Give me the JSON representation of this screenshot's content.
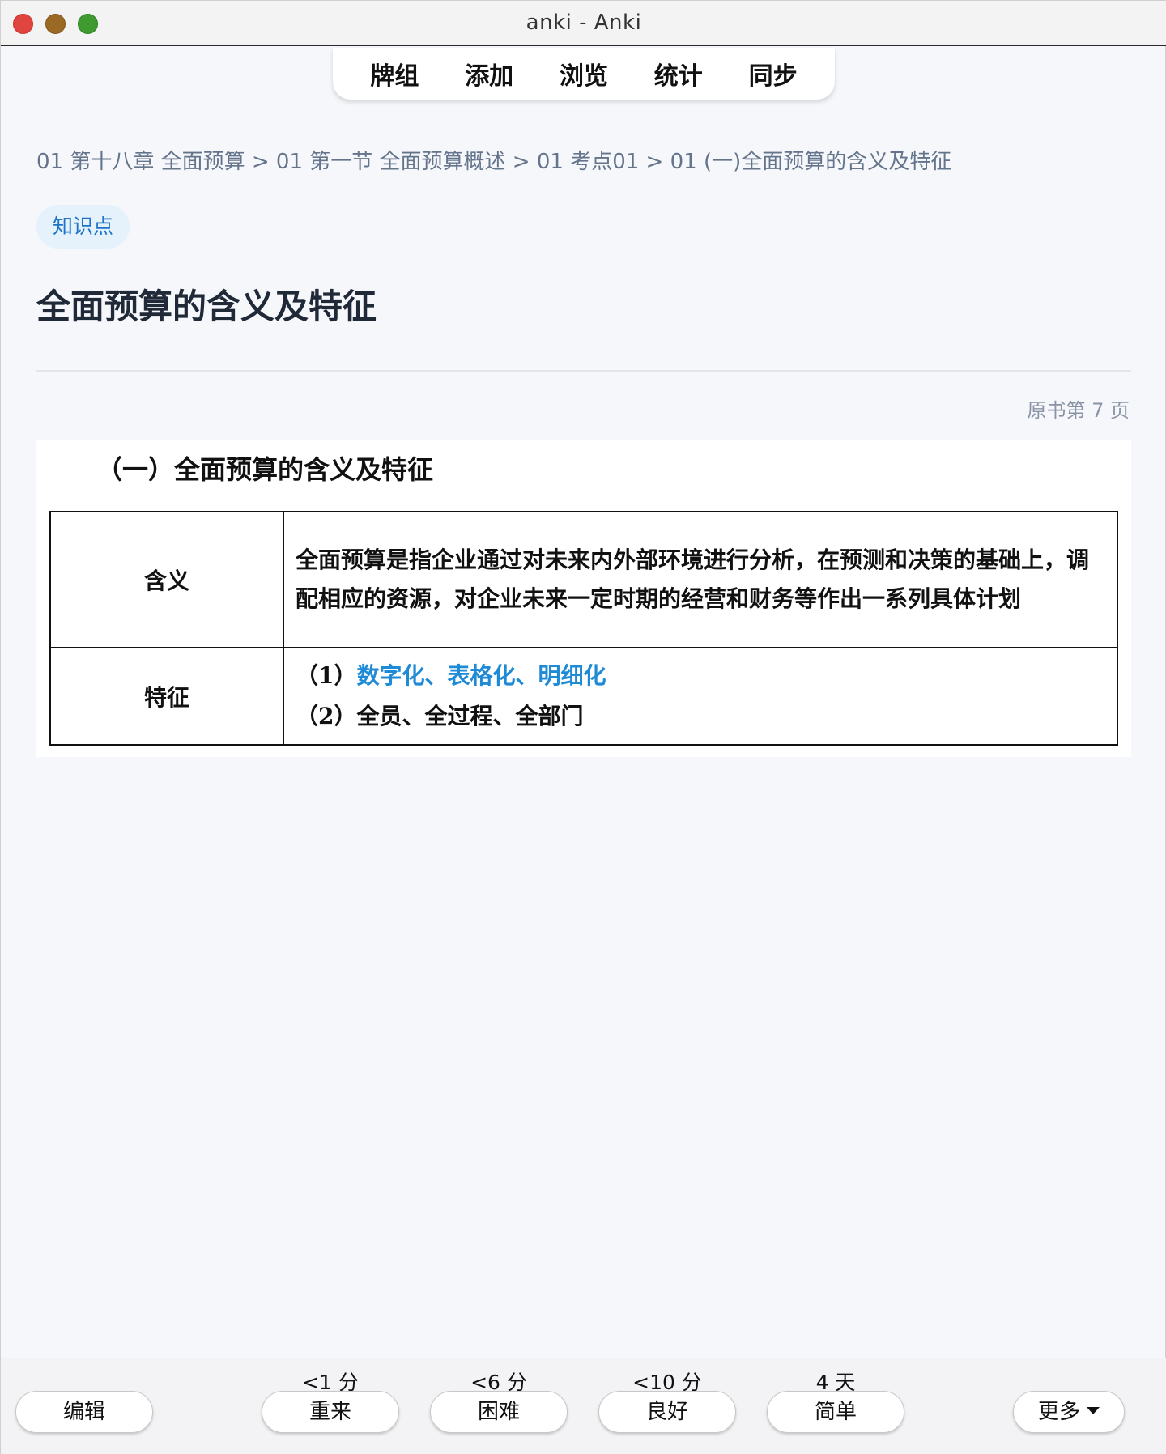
{
  "window": {
    "title": "anki - Anki"
  },
  "toolbar": {
    "items": [
      "牌组",
      "添加",
      "浏览",
      "统计",
      "同步"
    ]
  },
  "card": {
    "breadcrumb": "01 第十八章 全面预算 > 01 第一节 全面预算概述 > 01 考点01 > 01 (一)全面预算的含义及特征",
    "tag": "知识点",
    "title": "全面预算的含义及特征",
    "page_ref": "原书第 7 页",
    "scan": {
      "heading": "（一）全面预算的含义及特征",
      "rows": [
        {
          "label": "含义",
          "content": "全面预算是指企业通过对未来内外部环境进行分析，在预测和决策的基础上，调配相应的资源，对企业未来一定时期的经营和财务等作出一系列具体计划"
        },
        {
          "label": "特征",
          "items": [
            {
              "prefix": "（1）",
              "text": "数字化、表格化、明细化"
            },
            {
              "prefix": "（2）",
              "text": "全员、全过程、全部门"
            }
          ]
        }
      ]
    }
  },
  "bottom": {
    "edit_label": "编辑",
    "answers": [
      {
        "interval": "<1 分",
        "label": "重来"
      },
      {
        "interval": "<6 分",
        "label": "困难"
      },
      {
        "interval": "<10 分",
        "label": "良好"
      },
      {
        "interval": "4 天",
        "label": "简单"
      }
    ],
    "more_label": "更多"
  },
  "colors": {
    "highlight": "#1f8ad6",
    "tag_bg": "#e5f1fb",
    "tag_text": "#1d74c6",
    "background": "#f6f7fb"
  }
}
